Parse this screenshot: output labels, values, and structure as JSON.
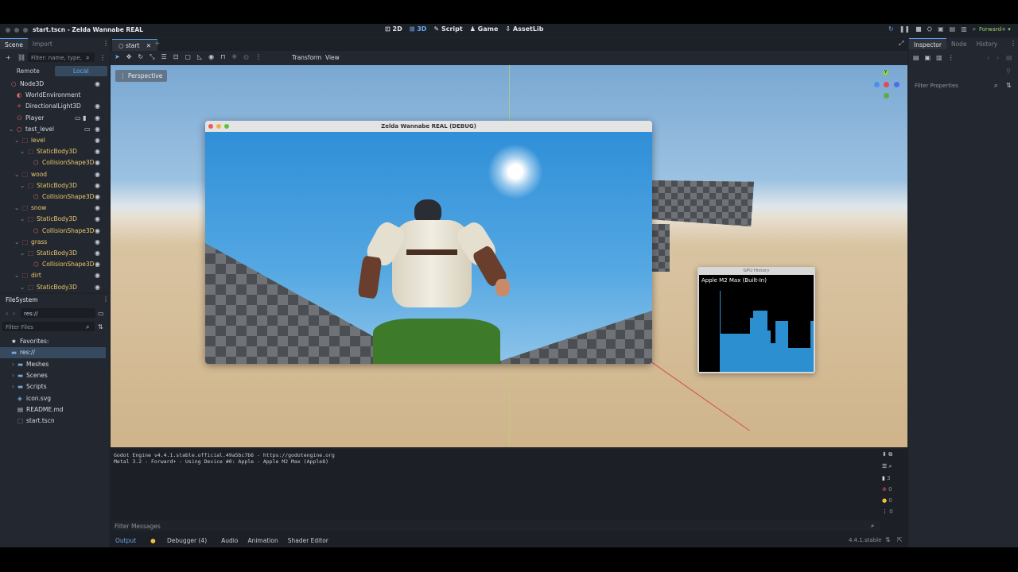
{
  "window": {
    "title": "start.tscn - Zelda Wannabe REAL",
    "modes": [
      {
        "label": "2D",
        "icon": "2d-icon"
      },
      {
        "label": "3D",
        "icon": "3d-icon"
      },
      {
        "label": "Script",
        "icon": "script-icon"
      },
      {
        "label": "Game",
        "icon": "game-icon"
      },
      {
        "label": "AssetLib",
        "icon": "assetlib-icon"
      }
    ],
    "active_mode": "3D",
    "renderer": "Forward+"
  },
  "scene_dock": {
    "tabs": [
      "Scene",
      "Import"
    ],
    "filter_placeholder": "Filter: name, type,",
    "remote": "Remote",
    "local": "Local",
    "nodes": [
      {
        "label": "Node3D",
        "depth": 0,
        "color": "#ef6b6b",
        "text_color": "#d8dbe0"
      },
      {
        "label": "WorldEnvironment",
        "depth": 1,
        "color": "#ef6b6b",
        "text_color": "#d8dbe0"
      },
      {
        "label": "DirectionalLight3D",
        "depth": 1,
        "color": "#ef6b6b",
        "text_color": "#d8dbe0"
      },
      {
        "label": "Player",
        "depth": 1,
        "color": "#ef6b6b",
        "text_color": "#d8dbe0"
      },
      {
        "label": "test_level",
        "depth": 1,
        "color": "#ef6b6b",
        "text_color": "#d8dbe0"
      },
      {
        "label": "level",
        "depth": 2,
        "color": "#ef6b6b",
        "text_color": "#e8c66b"
      },
      {
        "label": "StaticBody3D",
        "depth": 3,
        "color": "#ef6b6b",
        "text_color": "#e8c66b"
      },
      {
        "label": "CollisionShape3D",
        "depth": 4,
        "color": "#ef6b6b",
        "text_color": "#e8c66b"
      },
      {
        "label": "wood",
        "depth": 2,
        "color": "#ef6b6b",
        "text_color": "#e8c66b"
      },
      {
        "label": "StaticBody3D",
        "depth": 3,
        "color": "#ef6b6b",
        "text_color": "#e8c66b"
      },
      {
        "label": "CollisionShape3D",
        "depth": 4,
        "color": "#ef6b6b",
        "text_color": "#e8c66b"
      },
      {
        "label": "snow",
        "depth": 2,
        "color": "#ef6b6b",
        "text_color": "#e8c66b"
      },
      {
        "label": "StaticBody3D",
        "depth": 3,
        "color": "#ef6b6b",
        "text_color": "#e8c66b"
      },
      {
        "label": "CollisionShape3D",
        "depth": 4,
        "color": "#ef6b6b",
        "text_color": "#e8c66b"
      },
      {
        "label": "grass",
        "depth": 2,
        "color": "#ef6b6b",
        "text_color": "#e8c66b"
      },
      {
        "label": "StaticBody3D",
        "depth": 3,
        "color": "#ef6b6b",
        "text_color": "#e8c66b"
      },
      {
        "label": "CollisionShape3D",
        "depth": 4,
        "color": "#ef6b6b",
        "text_color": "#e8c66b"
      },
      {
        "label": "dirt",
        "depth": 2,
        "color": "#ef6b6b",
        "text_color": "#e8c66b"
      },
      {
        "label": "StaticBody3D",
        "depth": 3,
        "color": "#ef6b6b",
        "text_color": "#e8c66b"
      }
    ]
  },
  "filesystem": {
    "title": "FileSystem",
    "path": "res://",
    "filter_placeholder": "Filter Files",
    "items": [
      {
        "label": "Favorites:",
        "depth": 0,
        "icon": "star-icon"
      },
      {
        "label": "res://",
        "depth": 0,
        "icon": "folder-icon",
        "selected": true
      },
      {
        "label": "Meshes",
        "depth": 1,
        "icon": "folder-icon"
      },
      {
        "label": "Scenes",
        "depth": 1,
        "icon": "folder-icon"
      },
      {
        "label": "Scripts",
        "depth": 1,
        "icon": "folder-icon"
      },
      {
        "label": "icon.svg",
        "depth": 1,
        "icon": "image-icon"
      },
      {
        "label": "README.md",
        "depth": 1,
        "icon": "text-file-icon"
      },
      {
        "label": "start.tscn",
        "depth": 1,
        "icon": "scene-icon"
      }
    ]
  },
  "editor": {
    "scene_tab": "start",
    "toolbar_menus": [
      "Transform",
      "View"
    ],
    "perspective": "Perspective"
  },
  "game_window": {
    "title": "Zelda Wannabe REAL (DEBUG)"
  },
  "gpu_window": {
    "title": "GPU History",
    "device": "Apple M2 Max (Built-In)"
  },
  "output": {
    "lines": [
      "Godot Engine v4.4.1.stable.official.49a5bc7b6 - https://godotengine.org",
      "Metal 3.2 - Forward+ - Using Device #0: Apple - Apple M2 Max (Apple8)"
    ],
    "filter_placeholder": "Filter Messages",
    "counts": {
      "info": "3",
      "errors": "0",
      "warnings": "0",
      "messages": "0"
    }
  },
  "bottom_tabs": [
    "Output",
    "Debugger (4)",
    "Audio",
    "Animation",
    "Shader Editor"
  ],
  "version": "4.4.1.stable",
  "inspector": {
    "tabs": [
      "Inspector",
      "Node",
      "History"
    ],
    "filter_placeholder": "Filter Properties"
  }
}
